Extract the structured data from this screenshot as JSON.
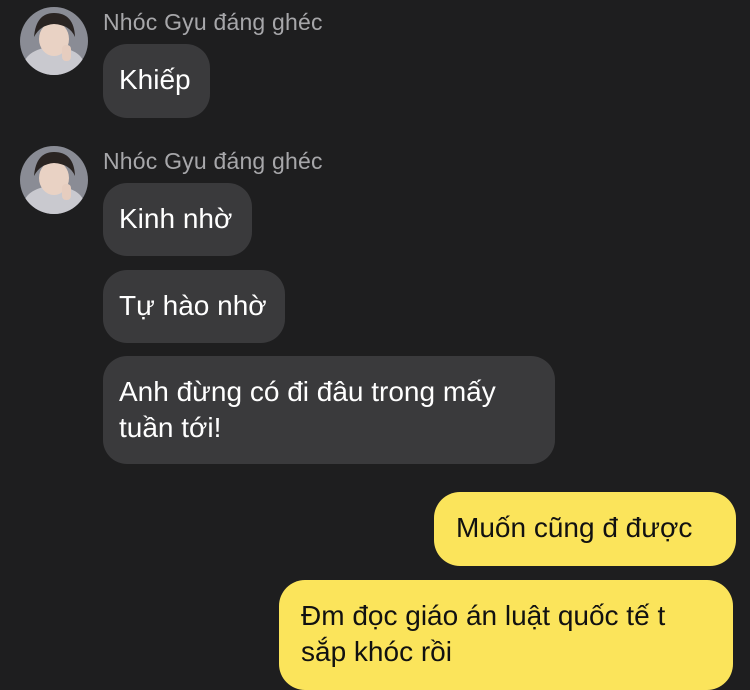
{
  "conversation": {
    "colors": {
      "background": "#1e1e1f",
      "incoming_bubble": "#3a3a3c",
      "outgoing_bubble": "#fbe45b",
      "sender_name": "#a7a7aa"
    },
    "groups": [
      {
        "sender": "Nhóc Gyu đáng ghéc",
        "avatar_icon": "user-avatar-photo",
        "messages": [
          {
            "lines": [
              "Khiếp"
            ]
          }
        ]
      },
      {
        "sender": "Nhóc Gyu đáng ghéc",
        "avatar_icon": "user-avatar-photo",
        "messages": [
          {
            "lines": [
              "Kinh nhờ"
            ]
          },
          {
            "lines": [
              "Tự hào nhờ"
            ]
          },
          {
            "lines": [
              "Anh đừng có đi đâu trong mấy",
              "tuần tới!"
            ]
          }
        ]
      }
    ],
    "outgoing": [
      {
        "lines": [
          "Muốn cũng đ được"
        ]
      },
      {
        "lines": [
          "Đm đọc giáo án luật quốc tế t",
          "sắp khóc rồi"
        ]
      }
    ]
  }
}
